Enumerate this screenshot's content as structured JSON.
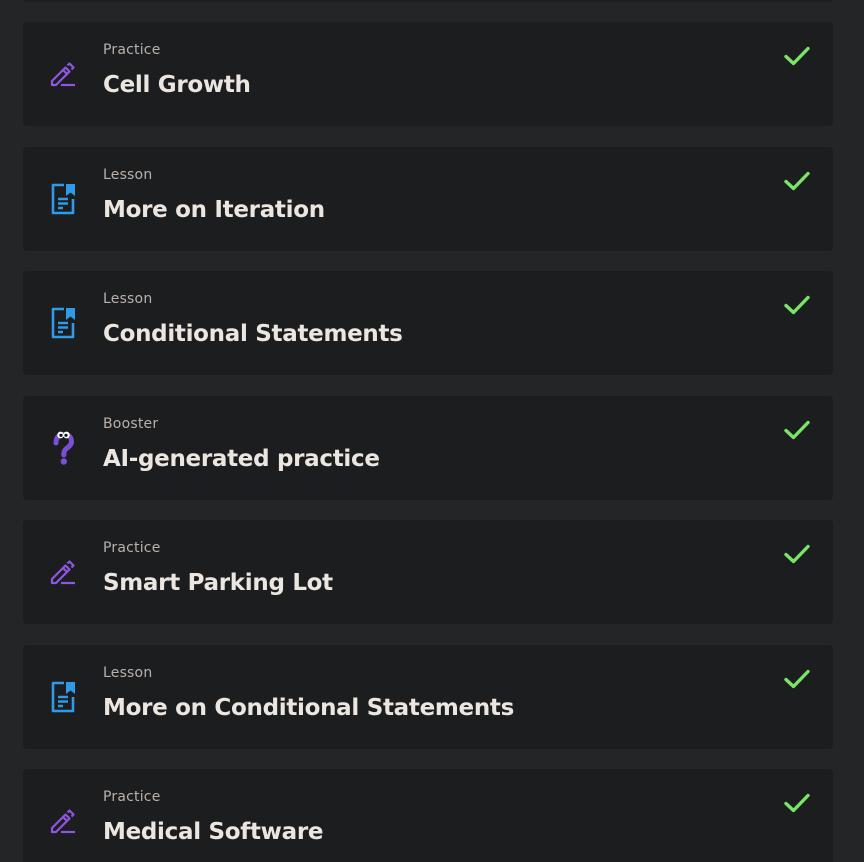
{
  "colors": {
    "page_background": "#242526",
    "card_background": "#1c1d1f",
    "type_text": "#b7b2ad",
    "title_text": "#ece6e0",
    "practice_icon": "#8e57e3",
    "lesson_icon": "#2f9ae8",
    "booster_icon": "#7a4fd6",
    "check": "#7be366"
  },
  "items": [
    {
      "type": "Practice",
      "title": "Cell Growth",
      "icon": "pencil-icon",
      "completed": true
    },
    {
      "type": "Lesson",
      "title": "More on Iteration",
      "icon": "lesson-doc-icon",
      "completed": true
    },
    {
      "type": "Lesson",
      "title": "Conditional Statements",
      "icon": "lesson-doc-icon",
      "completed": true
    },
    {
      "type": "Booster",
      "title": "AI-generated practice",
      "icon": "question-mark-icon",
      "completed": true
    },
    {
      "type": "Practice",
      "title": "Smart Parking Lot",
      "icon": "pencil-icon",
      "completed": true
    },
    {
      "type": "Lesson",
      "title": "More on Conditional Statements",
      "icon": "lesson-doc-icon",
      "completed": true
    },
    {
      "type": "Practice",
      "title": "Medical Software",
      "icon": "pencil-icon",
      "completed": true
    }
  ]
}
